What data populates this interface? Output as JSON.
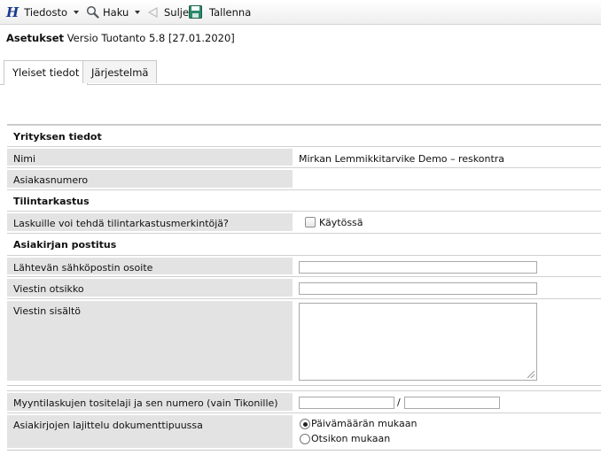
{
  "toolbar": {
    "file_label": "Tiedosto",
    "search_label": "Haku",
    "close_label": "Sulje",
    "save_label": "Tallenna",
    "accent": "#1b3a8f",
    "save_icon_color": "#2b8a6e"
  },
  "title": {
    "bold": "Asetukset",
    "rest": "Versio Tuotanto 5.8 [27.01.2020]"
  },
  "tabs": [
    {
      "label": "Yleiset tiedot",
      "active": true
    },
    {
      "label": "Järjestelmä",
      "active": false
    }
  ],
  "sections": {
    "company": {
      "heading": "Yrityksen tiedot",
      "name_label": "Nimi",
      "name_value": "Mirkan Lemmikkitarvike Demo – reskontra",
      "customer_number_label": "Asiakasnumero",
      "customer_number_value": ""
    },
    "audit": {
      "heading": "Tilintarkastus",
      "question_label": "Laskuille voi tehdä tilintarkastusmerkintöjä?",
      "checkbox_label": "Käytössä",
      "checked": false
    },
    "mailing": {
      "heading": "Asiakirjan postitus",
      "sender_email_label": "Lähtevän sähköpostin osoite",
      "sender_email_value": "",
      "subject_label": "Viestin otsikko",
      "subject_value": "",
      "body_label": "Viestin sisältö",
      "body_value": "",
      "voucher_label": "Myyntilaskujen tositelaji ja sen numero (vain Tikonille)",
      "voucher_type_value": "",
      "voucher_separator": "/",
      "voucher_number_value": "",
      "sorting_label": "Asiakirjojen lajittelu dokumenttipuussa",
      "sort_options": [
        {
          "label": "Päivämäärän mukaan",
          "selected": true
        },
        {
          "label": "Otsikon mukaan",
          "selected": false
        }
      ]
    }
  }
}
